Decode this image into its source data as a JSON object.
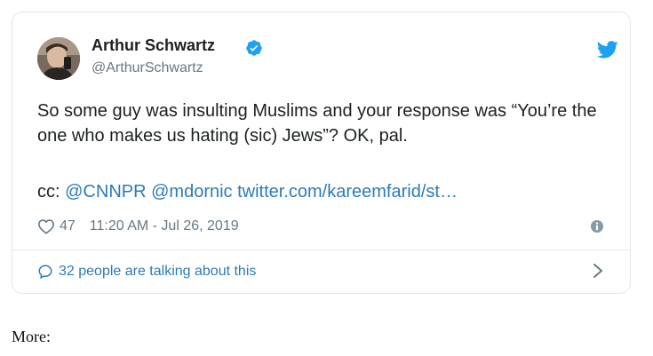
{
  "tweet": {
    "author_name": "Arthur Schwartz",
    "author_handle": "@ArthurSchwartz",
    "text": "So some guy was insulting Muslims and your response was “You’re the one who makes us hating (sic) Jews”? OK, pal.",
    "cc_prefix": "cc:",
    "mentions": [
      "@CNNPR",
      "@mdornic"
    ],
    "link": "twitter.com/kareemfarid/st…",
    "like_count": "47",
    "timestamp": "11:20 AM - Jul 26, 2019",
    "talking_text": "32 people are talking about this"
  },
  "footer": {
    "more_label": "More:"
  },
  "colors": {
    "link": "#2b7bb9",
    "meta": "#697882",
    "verified": "#1da1f2",
    "twitter_blue": "#1da1f2",
    "border": "#e1e8ed"
  },
  "icons": [
    "verified-badge-icon",
    "twitter-bird-icon",
    "heart-icon",
    "info-icon",
    "speech-bubble-icon",
    "chevron-right-icon"
  ]
}
